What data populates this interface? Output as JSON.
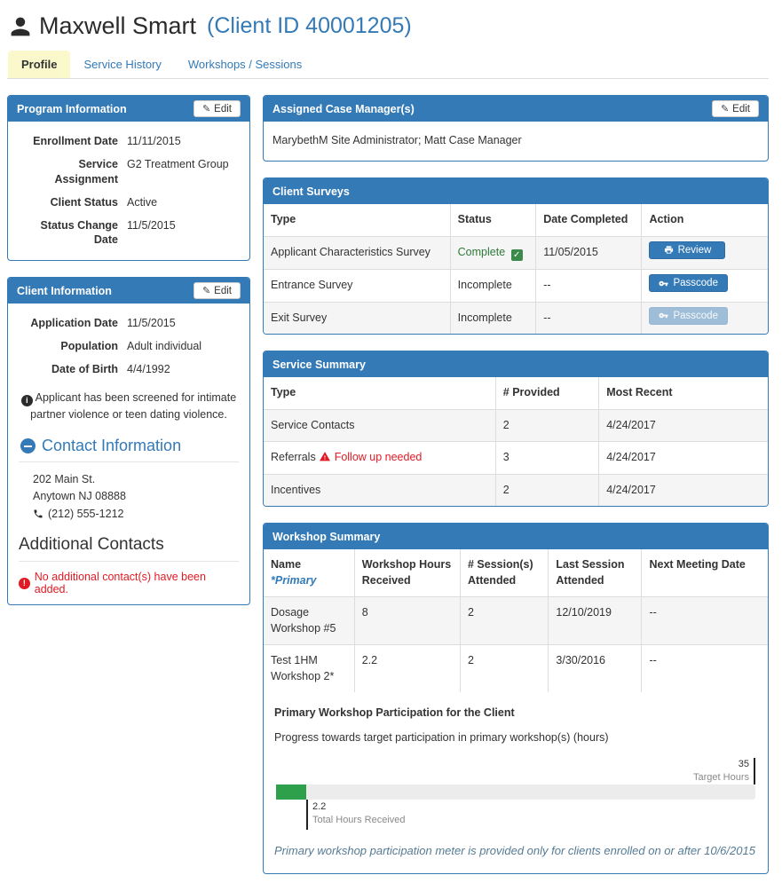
{
  "colors": {
    "accent_blue": "#337ab7",
    "tab_active_yellow": "#fbf8cc",
    "success_green": "#2ea04c",
    "alert_red": "#e01b24"
  },
  "header": {
    "client_name": "Maxwell Smart",
    "client_id": "(Client ID 40001205)"
  },
  "tabs": {
    "profile": "Profile",
    "service_history": "Service History",
    "workshops_sessions": "Workshops / Sessions"
  },
  "program_information": {
    "title": "Program Information",
    "edit_label": "Edit",
    "fields": [
      {
        "label": "Enrollment Date",
        "value": "11/11/2015"
      },
      {
        "label": "Service Assignment",
        "value": "G2 Treatment Group"
      },
      {
        "label": "Client Status",
        "value": "Active"
      },
      {
        "label": "Status Change Date",
        "value": "11/5/2015"
      }
    ]
  },
  "client_information": {
    "title": "Client Information",
    "edit_label": "Edit",
    "fields": [
      {
        "label": "Application Date",
        "value": "11/5/2015"
      },
      {
        "label": "Population",
        "value": "Adult individual"
      },
      {
        "label": "Date of Birth",
        "value": "4/4/1992"
      }
    ],
    "screening_note": "Applicant has been screened for intimate partner violence or teen dating violence.",
    "contact_section": {
      "title": "Contact Information",
      "address_line1": "202 Main St.",
      "address_line2": "Anytown NJ 08888",
      "phone": "(212) 555-1212"
    },
    "additional_contacts": {
      "title": "Additional Contacts",
      "empty_message": "No additional contact(s) have been added."
    }
  },
  "case_managers": {
    "title": "Assigned Case Manager(s)",
    "edit_label": "Edit",
    "value": "MarybethM Site Administrator; Matt Case Manager"
  },
  "client_surveys": {
    "title": "Client Surveys",
    "columns": {
      "type": "Type",
      "status": "Status",
      "date": "Date Completed",
      "action": "Action"
    },
    "rows": [
      {
        "type": "Applicant Characteristics Survey",
        "status": "Complete",
        "date": "11/05/2015",
        "action": "Review"
      },
      {
        "type": "Entrance Survey",
        "status": "Incomplete",
        "date": "--",
        "action": "Passcode"
      },
      {
        "type": "Exit Survey",
        "status": "Incomplete",
        "date": "--",
        "action": "Passcode"
      }
    ]
  },
  "service_summary": {
    "title": "Service Summary",
    "columns": {
      "type": "Type",
      "provided": "# Provided",
      "recent": "Most Recent"
    },
    "rows": [
      {
        "type": "Service Contacts",
        "provided": "2",
        "recent": "4/24/2017"
      },
      {
        "type": "Referrals",
        "warning": "Follow up needed",
        "provided": "3",
        "recent": "4/24/2017"
      },
      {
        "type": "Incentives",
        "provided": "2",
        "recent": "4/24/2017"
      }
    ]
  },
  "workshop_summary": {
    "title": "Workshop Summary",
    "columns": {
      "name": "Name",
      "primary_note": "*Primary",
      "hours": "Workshop Hours Received",
      "sessions": "# Session(s) Attended",
      "last": "Last Session Attended",
      "next": "Next Meeting Date"
    },
    "rows": [
      {
        "name": "Dosage Workshop #5",
        "hours": "8",
        "sessions": "2",
        "last": "12/10/2019",
        "next": "--"
      },
      {
        "name": "Test 1HM Workshop 2*",
        "hours": "2.2",
        "sessions": "2",
        "last": "3/30/2016",
        "next": "--"
      }
    ],
    "participation": {
      "heading": "Primary Workshop Participation for the Client",
      "subheading": "Progress towards target participation in primary workshop(s) (hours)",
      "target_value": "35",
      "target_label": "Target Hours",
      "received_value": "2.2",
      "received_label": "Total Hours Received",
      "target_hours": 35,
      "received_hours": 2.2,
      "percent": 6.29,
      "note": "Primary workshop participation meter is provided only for clients enrolled on or after 10/6/2015"
    }
  }
}
